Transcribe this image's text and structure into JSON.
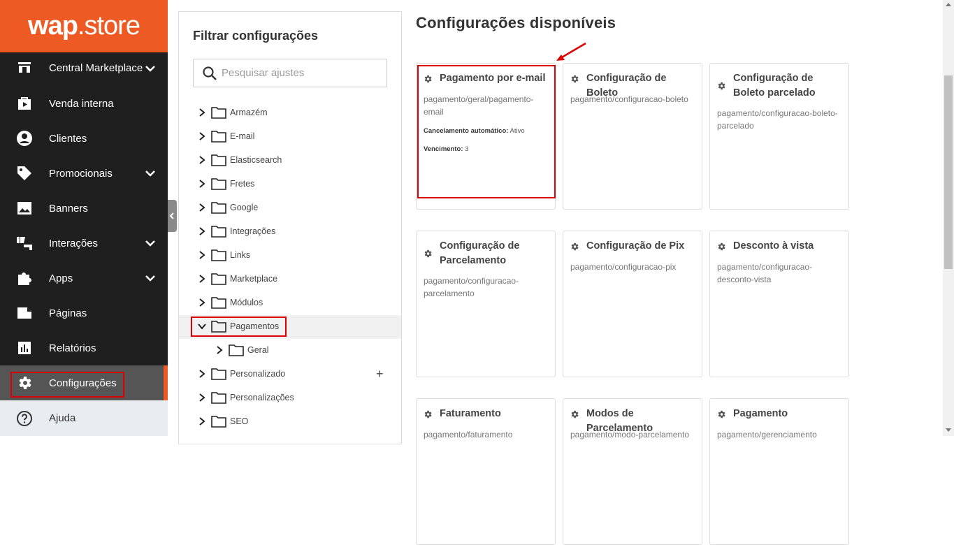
{
  "brand": {
    "logo_bold": "wap",
    "logo_light": ".store",
    "accent": "#ee5a24"
  },
  "sidebar": {
    "items": [
      {
        "label": "Central Marketplace",
        "icon": "storefront-icon",
        "has_chevron": true
      },
      {
        "label": "Venda interna",
        "icon": "shopping-bag-icon",
        "has_chevron": false
      },
      {
        "label": "Clientes",
        "icon": "user-circle-icon",
        "has_chevron": false
      },
      {
        "label": "Promocionais",
        "icon": "tag-icon",
        "has_chevron": true
      },
      {
        "label": "Banners",
        "icon": "image-icon",
        "has_chevron": false
      },
      {
        "label": "Interações",
        "icon": "thumbs-icon",
        "has_chevron": true
      },
      {
        "label": "Apps",
        "icon": "puzzle-icon",
        "has_chevron": true
      },
      {
        "label": "Páginas",
        "icon": "page-icon",
        "has_chevron": false
      },
      {
        "label": "Relatórios",
        "icon": "bar-chart-icon",
        "has_chevron": false
      },
      {
        "label": "Configurações",
        "icon": "gear-icon",
        "has_chevron": false,
        "active": true
      },
      {
        "label": "Ajuda",
        "icon": "help-circle-icon",
        "has_chevron": false
      }
    ]
  },
  "filter": {
    "title": "Filtrar configurações",
    "search_placeholder": "Pesquisar ajustes",
    "tree": [
      {
        "label": "Armazém",
        "expanded": false
      },
      {
        "label": "E-mail",
        "expanded": false
      },
      {
        "label": "Elasticsearch",
        "expanded": false
      },
      {
        "label": "Fretes",
        "expanded": false
      },
      {
        "label": "Google",
        "expanded": false
      },
      {
        "label": "Integrações",
        "expanded": false
      },
      {
        "label": "Links",
        "expanded": false
      },
      {
        "label": "Marketplace",
        "expanded": false
      },
      {
        "label": "Módulos",
        "expanded": false
      },
      {
        "label": "Pagamentos",
        "expanded": true,
        "selected": true
      },
      {
        "label": "Geral",
        "expanded": false,
        "child": true
      },
      {
        "label": "Personalizado",
        "expanded": false,
        "action": "+"
      },
      {
        "label": "Personalizações",
        "expanded": false
      },
      {
        "label": "SEO",
        "expanded": false
      }
    ]
  },
  "main": {
    "title": "Configurações disponíveis",
    "cards": [
      {
        "title": "Pagamento por e-mail",
        "path": "pagamento/geral/pagamento-email",
        "meta": [
          {
            "key": "Cancelamento automático:",
            "value": "Ativo"
          },
          {
            "key": "Vencimento:",
            "value": "3"
          }
        ]
      },
      {
        "title": "Configuração de Boleto",
        "path": "pagamento/configuracao-boleto"
      },
      {
        "title": "Configuração de Boleto parcelado",
        "path": "pagamento/configuracao-boleto-parcelado"
      },
      {
        "title": "Configuração de Parcelamento",
        "path": "pagamento/configuracao-parcelamento"
      },
      {
        "title": "Configuração de Pix",
        "path": "pagamento/configuracao-pix"
      },
      {
        "title": "Desconto à vista",
        "path": "pagamento/configuracao-desconto-vista"
      },
      {
        "title": "Faturamento",
        "path": "pagamento/faturamento"
      },
      {
        "title": "Modos de Parcelamento",
        "path": "pagamento/modo-parcelamento"
      },
      {
        "title": "Pagamento",
        "path": "pagamento/gerenciamento"
      }
    ]
  },
  "annotation_color": "#dd0000"
}
